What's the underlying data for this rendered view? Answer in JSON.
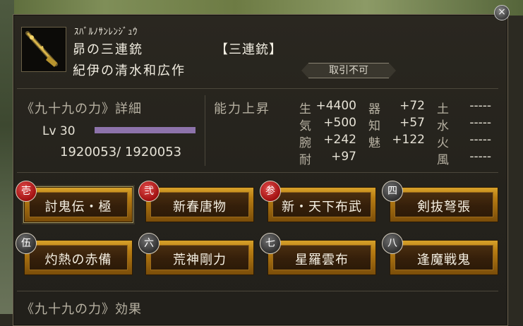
{
  "window": {
    "close_icon": "×"
  },
  "weapon": {
    "kana": "ｽﾊﾞﾙﾉｻﾝﾚﾝｼﾞｭｳ",
    "name": "昴の三連銃",
    "type": "【三連銃】",
    "smith": "紀伊の清水和広作",
    "trade_status": "取引不可",
    "icon": "golden-rifle-icon"
  },
  "power": {
    "title": "《九十九の力》詳細",
    "level_label": "Lv 30",
    "level_fill": 1.0,
    "exp_current": "1920053/",
    "exp_total": "1920053"
  },
  "ability": {
    "title": "能力上昇",
    "col1": [
      {
        "key": "生",
        "value": "+4400"
      },
      {
        "key": "気",
        "value": "+500"
      },
      {
        "key": "腕",
        "value": "+242"
      },
      {
        "key": "耐",
        "value": "+97"
      }
    ],
    "col2": [
      {
        "key": "器",
        "value": "+72"
      },
      {
        "key": "知",
        "value": "+57"
      },
      {
        "key": "魅",
        "value": "+122"
      }
    ],
    "col3": [
      {
        "key": "土",
        "value": "-----"
      },
      {
        "key": "水",
        "value": "-----"
      },
      {
        "key": "火",
        "value": "-----"
      },
      {
        "key": "風",
        "value": "-----"
      }
    ]
  },
  "skills": [
    {
      "badge": "壱",
      "label": "討鬼伝・極",
      "color": "#c01818",
      "selected": true
    },
    {
      "badge": "弐",
      "label": "新春唐物",
      "color": "#c01818"
    },
    {
      "badge": "参",
      "label": "新・天下布武",
      "color": "#c01818"
    },
    {
      "badge": "四",
      "label": "剣抜弩張",
      "color": "#444444"
    },
    {
      "badge": "伍",
      "label": "灼熱の赤備",
      "color": "#444444"
    },
    {
      "badge": "六",
      "label": "荒神剛力",
      "color": "#444444"
    },
    {
      "badge": "七",
      "label": "星羅雲布",
      "color": "#444444"
    },
    {
      "badge": "八",
      "label": "逢魔戦鬼",
      "color": "#444444"
    }
  ],
  "effect_title": "《九十九の力》効果"
}
